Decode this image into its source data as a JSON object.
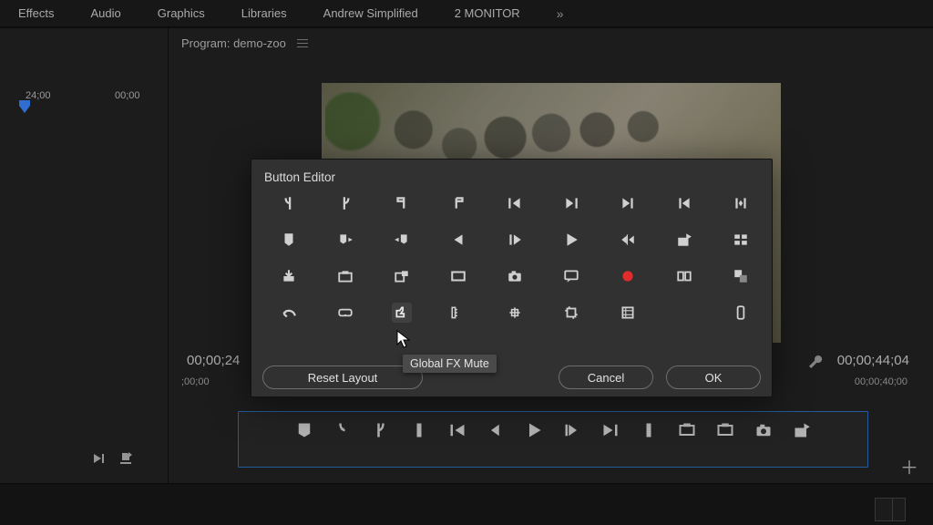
{
  "tabs": [
    "Effects",
    "Audio",
    "Graphics",
    "Libraries",
    "Andrew Simplified",
    "2 MONITOR"
  ],
  "tab_overflow_glyph": "»",
  "left_ruler": {
    "tick_a": "24;00",
    "tick_b": "00;00"
  },
  "program": {
    "title": "Program: demo-zoo",
    "tc_current": "00;00;24",
    "tc_total": "00;00;44;04",
    "mini_ruler_left": ";00;00",
    "mini_ruler_right": "00;00;40;00"
  },
  "modal": {
    "title": "Button Editor",
    "reset": "Reset Layout",
    "cancel": "Cancel",
    "ok": "OK",
    "tooltip": "Global FX Mute",
    "grid": [
      [
        "mark-in-icon",
        "mark-out-icon",
        "go-to-in-icon",
        "go-to-out-icon",
        "prev-edit-icon",
        "next-edit-icon",
        "insert-icon",
        "lift-icon",
        "extract-icon"
      ],
      [
        "marker-icon",
        "jump-marker-icon",
        "jump-prev-marker-icon",
        "step-back-icon",
        "step-fwd-icon",
        "play-icon",
        "shuttle-icon",
        "export-frame-icon",
        "multicam-icon"
      ],
      [
        "inbox-icon",
        "safe-margins-icon",
        "toggle-proxy-icon",
        "frame-icon",
        "camera-icon",
        "comment-icon",
        "record-icon",
        "comparison-view-icon",
        "swap-icon"
      ],
      [
        "undo-icon",
        "vr-icon",
        "fx-mute-icon",
        "ruler-icon",
        "grid-icon",
        "crop-icon",
        "filmstrip-icon",
        "",
        "phone-icon"
      ]
    ],
    "transport": [
      "marker-icon",
      "mark-in-icon",
      "mark-out-icon",
      "playhead-icon",
      "prev-edit-icon",
      "step-back-icon",
      "play-icon",
      "step-fwd-icon",
      "next-edit-icon",
      "playhead-out-icon",
      "safe-margins-a-icon",
      "safe-margins-b-icon",
      "camera-icon",
      "export-frame-icon"
    ]
  }
}
